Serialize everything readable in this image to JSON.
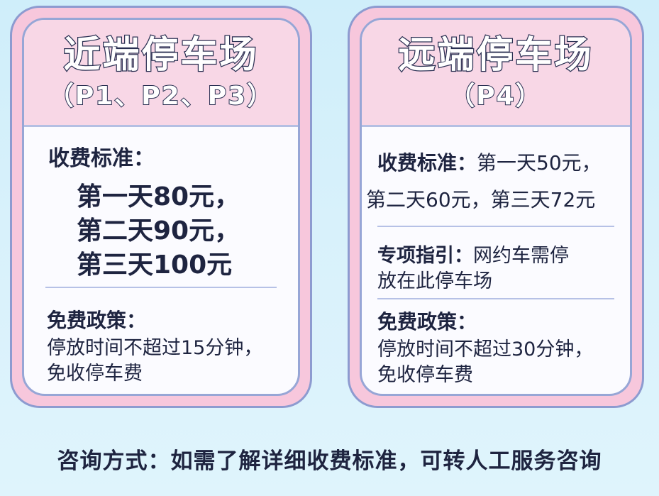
{
  "near": {
    "title": "近端停车场",
    "subtitle": "（P1、P2、P3）",
    "fee_label": "收费标准：",
    "fee_lines": [
      "第一天80元，",
      "第二天90元，",
      "第三天100元"
    ],
    "free_label": "免费政策：",
    "free_lines": [
      "停放时间不超过15分钟，",
      "免收停车费"
    ]
  },
  "far": {
    "title": "远端停车场",
    "subtitle": "（P4）",
    "fee_label": "收费标准：",
    "fee_line1_rest": "第一天50元，",
    "fee_line2": "第二天60元，第三天72元",
    "guide_label": "专项指引：",
    "guide_line1_rest": "网约车需停",
    "guide_line2": "放在此停车场",
    "free_label": "免费政策：",
    "free_lines": [
      "停放时间不超过30分钟，",
      "免收停车费"
    ]
  },
  "footer": {
    "label": "咨询方式：",
    "text": "如需了解详细收费标准，可转人工服务咨询"
  },
  "colors": {
    "background": "#d8f1fb",
    "card_outer": "#f7c7dc",
    "card_border": "#8d9bd0",
    "header_fill": "#f8d7e6",
    "text": "#1e2440"
  }
}
